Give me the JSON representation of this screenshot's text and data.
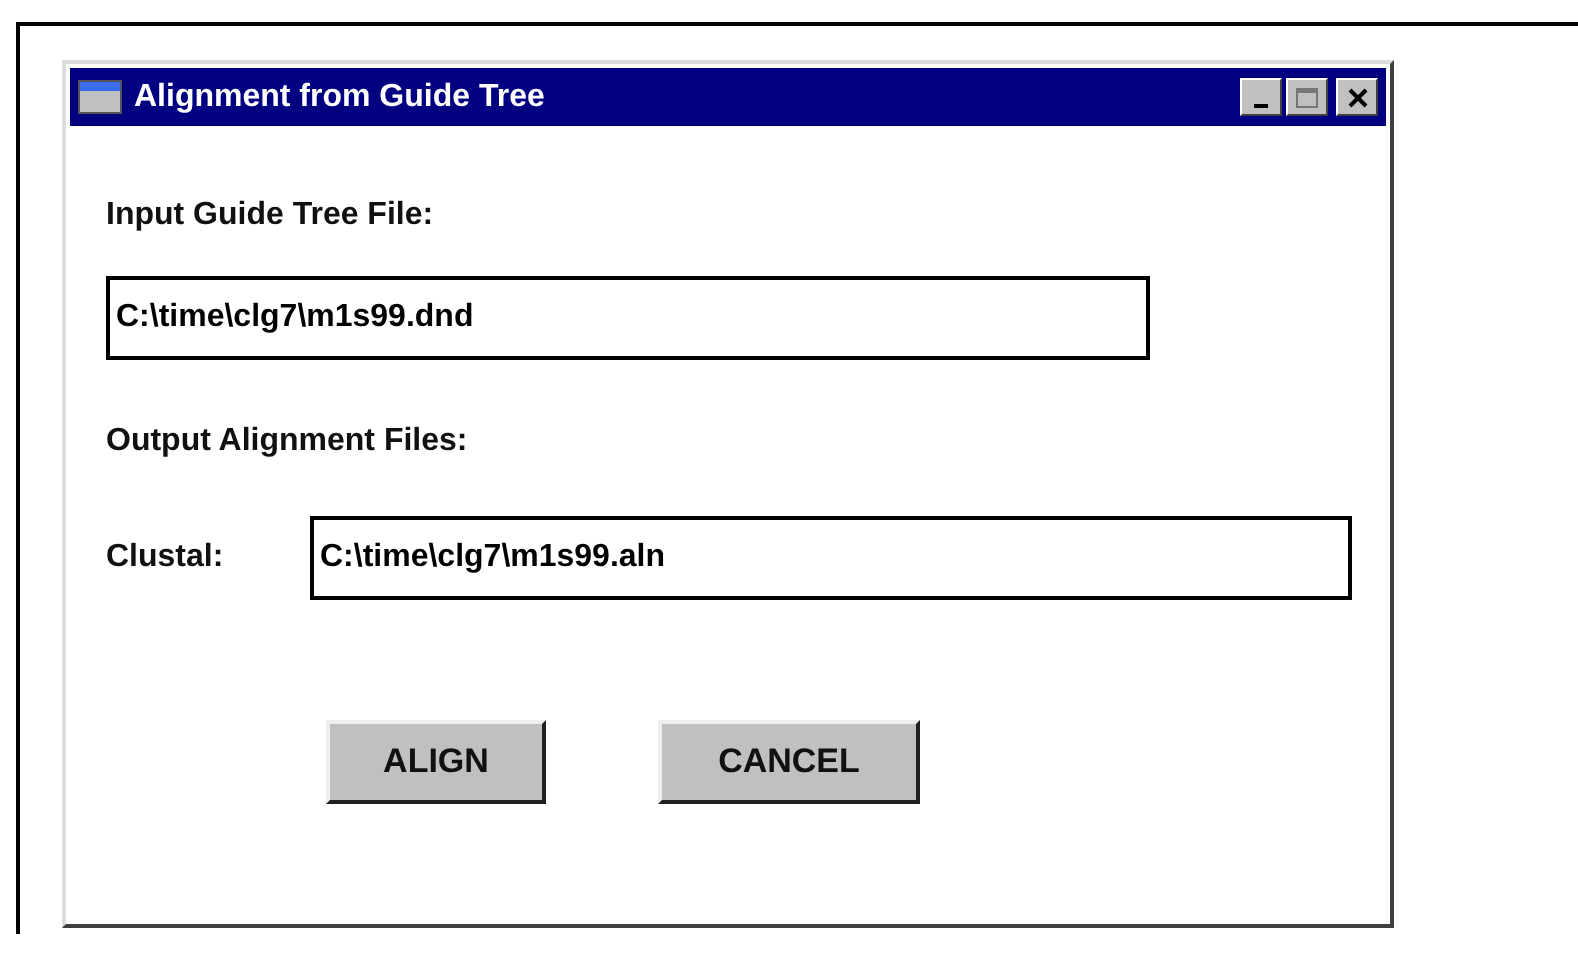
{
  "window": {
    "title": "Alignment from Guide Tree"
  },
  "input_label": "Input Guide Tree File:",
  "input_field": {
    "value": "C:\\time\\clg7\\m1s99.dnd"
  },
  "output_label": "Output Alignment Files:",
  "outputs": [
    {
      "label": "Clustal:",
      "value": "C:\\time\\clg7\\m1s99.aln"
    }
  ],
  "buttons": [
    "ALIGN",
    "CANCEL"
  ]
}
